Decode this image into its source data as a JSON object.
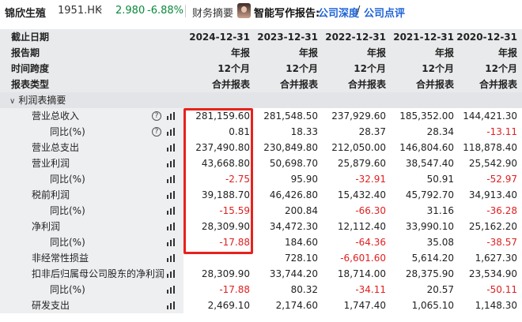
{
  "header": {
    "stock_name": "锦欣生殖",
    "stock_code": "1951.HK",
    "price": "2.980",
    "change_pct": "-6.88%",
    "nav_finance": "财务摘要",
    "ai_report_label": "智能写作报告:",
    "link_deep": "公司深度",
    "slash": "/",
    "link_review": "公司点评",
    "colors": {
      "down": "#0a8a3c",
      "link": "#1f64d8",
      "negative": "#e02020",
      "highlight_box": "#e8211d"
    }
  },
  "table": {
    "meta_rows": [
      {
        "label": "截止日期",
        "values": [
          "2024-12-31",
          "2023-12-31",
          "2022-12-31",
          "2021-12-31",
          "2020-12-31"
        ]
      },
      {
        "label": "报告期",
        "values": [
          "年报",
          "年报",
          "年报",
          "年报",
          "年报"
        ]
      },
      {
        "label": "时间跨度",
        "values": [
          "12个月",
          "12个月",
          "12个月",
          "12个月",
          "12个月"
        ]
      },
      {
        "label": "报表类型",
        "values": [
          "合并报表",
          "合并报表",
          "合并报表",
          "合并报表",
          "合并报表"
        ]
      }
    ],
    "section_title": "利润表摘要",
    "rows": [
      {
        "label": "营业总收入",
        "level": 1,
        "help": true,
        "values": [
          "281,159.60",
          "281,548.50",
          "237,929.60",
          "185,352.00",
          "144,421.30"
        ]
      },
      {
        "label": "同比(%)",
        "level": 2,
        "help": true,
        "values": [
          "0.81",
          "18.33",
          "28.37",
          "28.34",
          "-13.11"
        ]
      },
      {
        "label": "营业总支出",
        "level": 1,
        "help": false,
        "values": [
          "237,490.80",
          "230,849.80",
          "212,050.00",
          "146,804.60",
          "118,878.40"
        ]
      },
      {
        "label": "营业利润",
        "level": 1,
        "help": false,
        "values": [
          "43,668.80",
          "50,698.70",
          "25,879.60",
          "38,547.40",
          "25,542.90"
        ]
      },
      {
        "label": "同比(%)",
        "level": 2,
        "help": false,
        "values": [
          "-2.75",
          "95.90",
          "-32.91",
          "50.91",
          "-52.97"
        ]
      },
      {
        "label": "税前利润",
        "level": 1,
        "help": false,
        "values": [
          "39,188.70",
          "46,426.80",
          "15,432.40",
          "45,792.70",
          "34,913.40"
        ]
      },
      {
        "label": "同比(%)",
        "level": 2,
        "help": false,
        "values": [
          "-15.59",
          "200.84",
          "-66.30",
          "31.16",
          "-36.28"
        ]
      },
      {
        "label": "净利润",
        "level": 1,
        "help": false,
        "values": [
          "28,309.90",
          "34,472.30",
          "12,112.40",
          "33,990.10",
          "25,162.20"
        ]
      },
      {
        "label": "同比(%)",
        "level": 2,
        "help": false,
        "values": [
          "-17.88",
          "184.60",
          "-64.36",
          "35.08",
          "-38.57"
        ]
      },
      {
        "label": "非经常性损益",
        "level": 1,
        "help": false,
        "values": [
          "",
          "728.10",
          "-6,601.60",
          "5,614.20",
          "1,627.30"
        ]
      },
      {
        "label": "扣非后归属母公司股东的净利润",
        "level": 1,
        "help": false,
        "values": [
          "28,309.90",
          "33,744.20",
          "18,714.00",
          "28,375.90",
          "23,534.90"
        ]
      },
      {
        "label": "同比(%)",
        "level": 2,
        "help": false,
        "values": [
          "-17.88",
          "80.32",
          "-34.11",
          "20.57",
          "-50.11"
        ]
      },
      {
        "label": "研发支出",
        "level": 1,
        "help": false,
        "values": [
          "2,469.10",
          "2,174.60",
          "1,747.40",
          "1,065.10",
          "1,148.30"
        ]
      }
    ],
    "icons": {
      "help": "question-circle-icon",
      "chart": "bar-chart-icon"
    }
  }
}
